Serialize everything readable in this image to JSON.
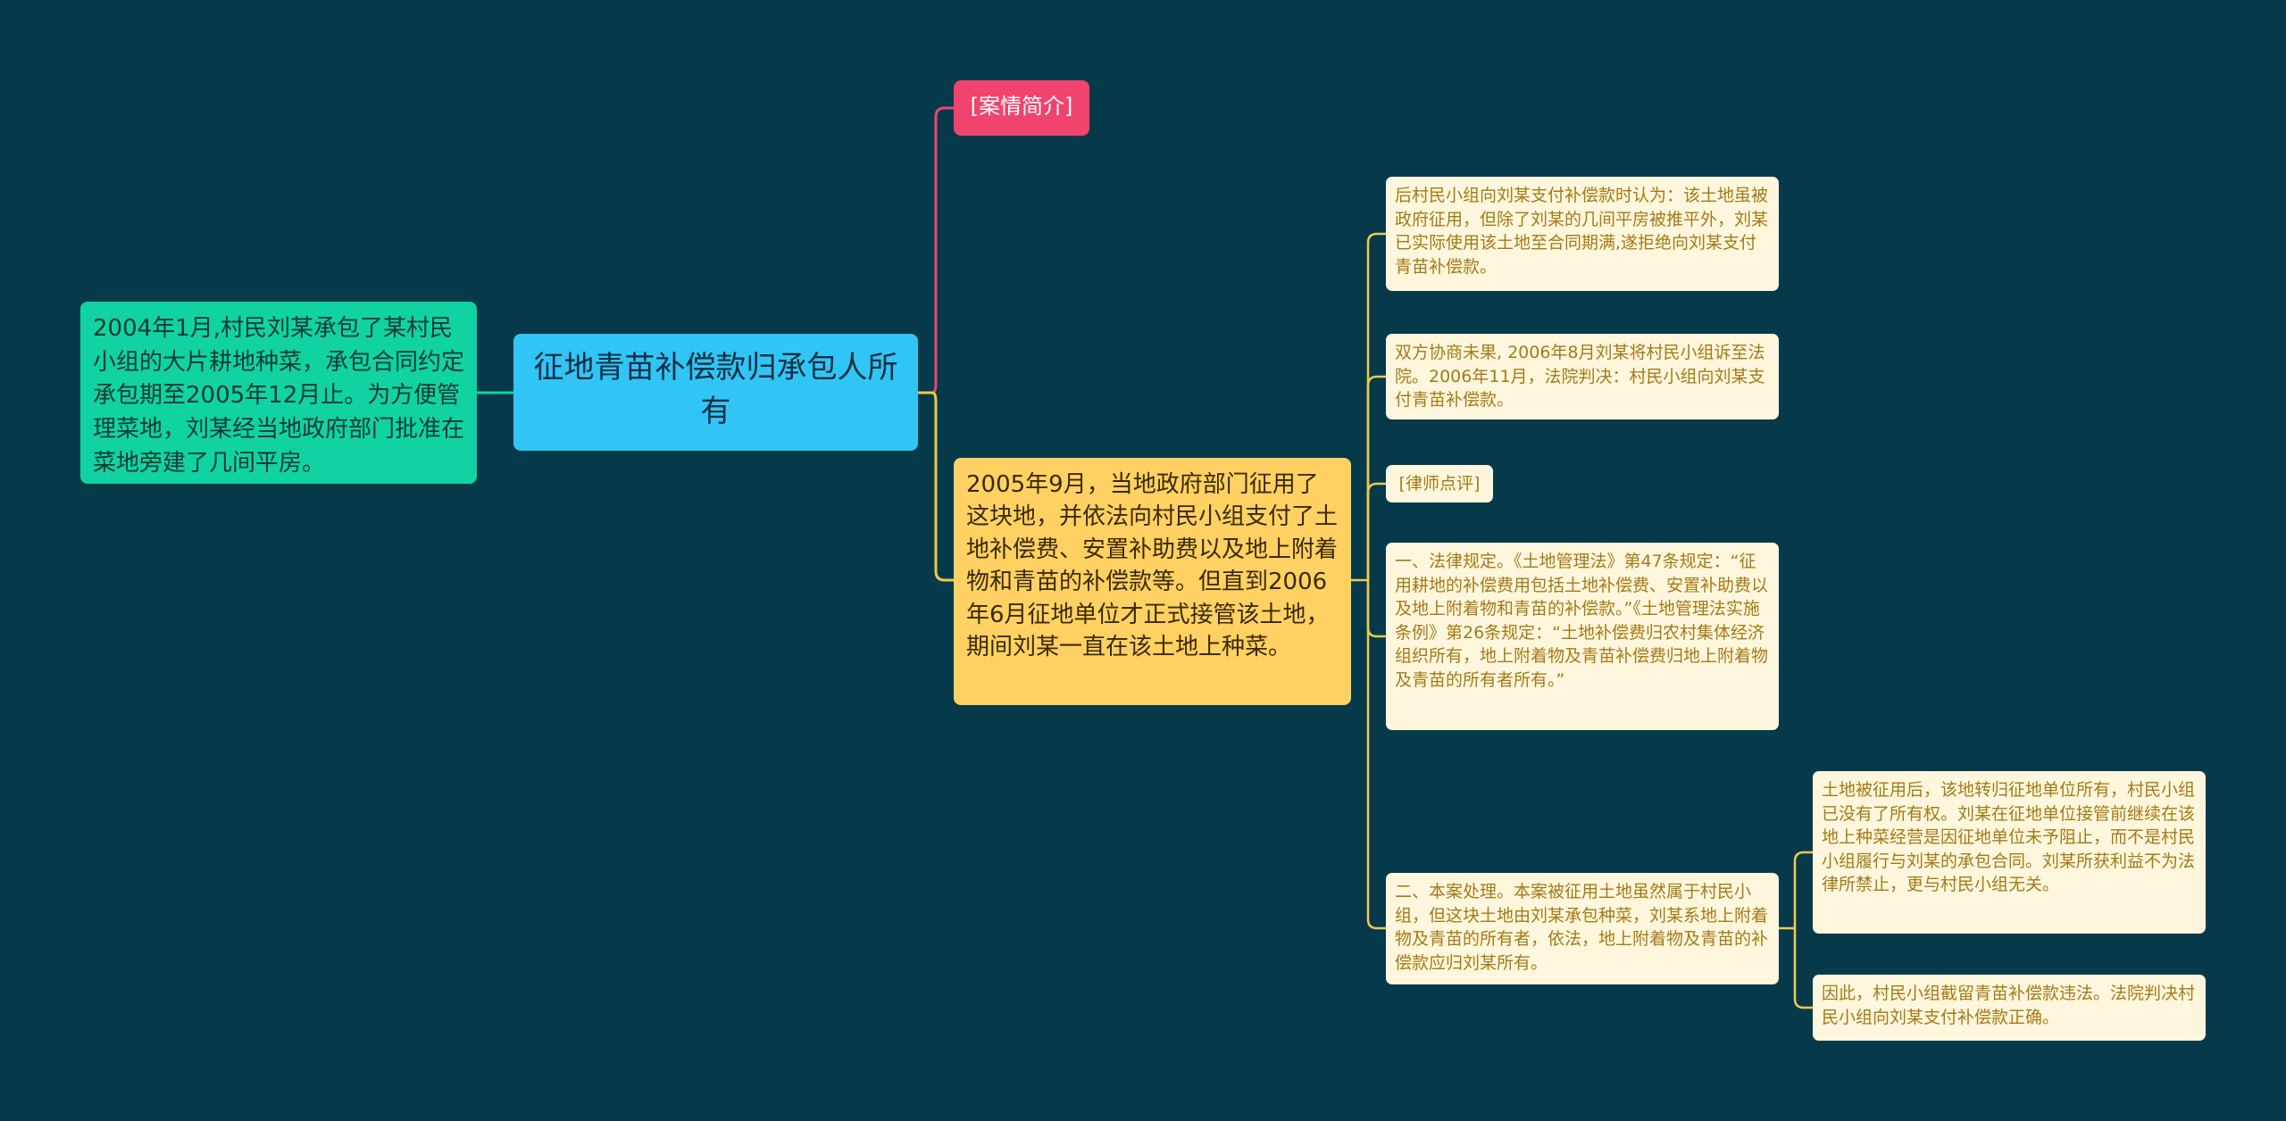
{
  "diagram": {
    "center": {
      "text": "征地青苗补偿款归承包人所有"
    },
    "left": {
      "text": "2004年1月,村民刘某承包了某村民小组的大片耕地种菜，承包合同约定承包期至2005年12月止。为方便管理菜地，刘某经当地政府部门批准在菜地旁建了几间平房。"
    },
    "intro_tag": {
      "text": "[案情简介]"
    },
    "main_right": {
      "text": "2005年9月，当地政府部门征用了这块地，并依法向村民小组支付了土地补偿费、安置补助费以及地上附着物和青苗的补偿款等。但直到2006年6月征地单位才正式接管该土地，期间刘某一直在该土地上种菜。"
    },
    "leaves": [
      {
        "text": "后村民小组向刘某支付补偿款时认为：该土地虽被政府征用，但除了刘某的几间平房被推平外，刘某已实际使用该土地至合同期满,遂拒绝向刘某支付青苗补偿款。"
      },
      {
        "text": "双方协商未果, 2006年8月刘某将村民小组诉至法院。2006年11月，法院判决：村民小组向刘某支付青苗补偿款。"
      },
      {
        "text": "[律师点评]"
      },
      {
        "text": "一、法律规定。《土地管理法》第47条规定：“征用耕地的补偿费用包括土地补偿费、安置补助费以及地上附着物和青苗的补偿款。”《土地管理法实施条例》第26条规定：“土地补偿费归农村集体经济组织所有，地上附着物及青苗补偿费归地上附着物及青苗的所有者所有。”"
      },
      {
        "text": "二、本案处理。本案被征用土地虽然属于村民小组，但这块土地由刘某承包种菜，刘某系地上附着物及青苗的所有者，依法，地上附着物及青苗的补偿款应归刘某所有。"
      },
      {
        "text": "土地被征用后，该地转归征地单位所有，村民小组已没有了所有权。刘某在征地单位接管前继续在该地上种菜经营是因征地单位未予阻止，而不是村民小组履行与刘某的承包合同。刘某所获利益不为法律所禁止，更与村民小组无关。"
      },
      {
        "text": "因此，村民小组截留青苗补偿款违法。法院判决村民小组向刘某支付补偿款正确。"
      }
    ],
    "colors": {
      "background": "#063a4b",
      "center": "#30c5f5",
      "left": "#10d3a1",
      "intro_tag": "#f0436e",
      "main_right": "#ffd163",
      "leaf": "#fff7dd",
      "link_green": "#10d3a1",
      "link_pink": "#f0436e",
      "link_yellow": "#f2c94c"
    }
  }
}
